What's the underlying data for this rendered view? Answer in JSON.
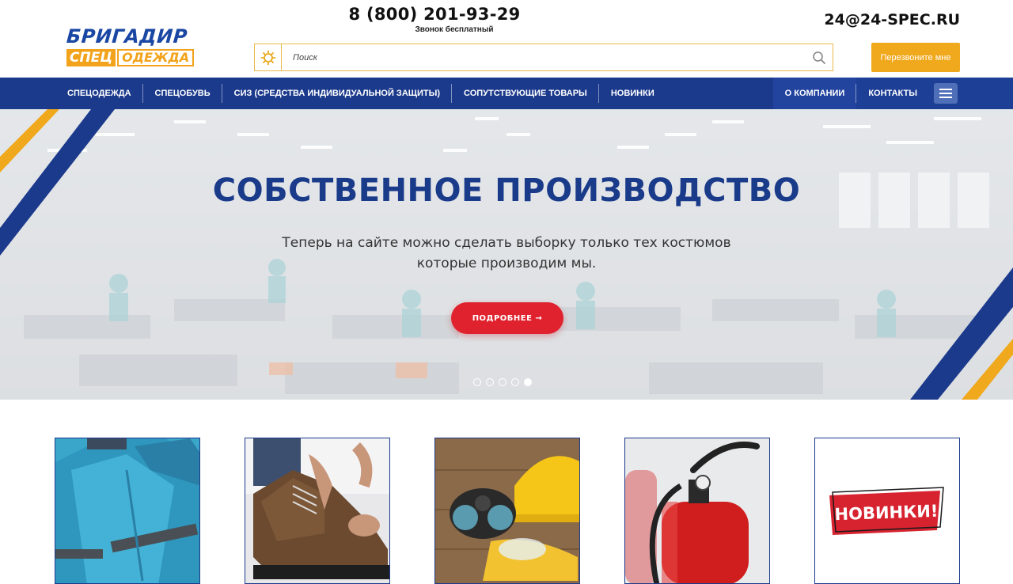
{
  "header": {
    "logo": {
      "top": "БРИГАДИР",
      "spec": "СПЕЦ",
      "od": "ОДЕЖДА"
    },
    "phone": "8 (800) 201-93-29",
    "phone_note": "Звонок бесплатный",
    "email": "24@24-SPEC.RU",
    "search_placeholder": "Поиск",
    "callback_label": "Перезвоните мне"
  },
  "nav": {
    "items": [
      {
        "label": "СПЕЦОДЕЖДА"
      },
      {
        "label": "СПЕЦОБУВЬ"
      },
      {
        "label": "СИЗ (СРЕДСТВА ИНДИВИДУАЛЬНОЙ ЗАЩИТЫ)"
      },
      {
        "label": "СОПУТСТВУЮЩИЕ ТОВАРЫ"
      },
      {
        "label": "НОВИНКИ"
      }
    ],
    "right_items": [
      {
        "label": "О КОМПАНИИ"
      },
      {
        "label": "КОНТАКТЫ"
      }
    ],
    "menu_icon": "hamburger-icon"
  },
  "hero": {
    "title": "СОБСТВЕННОЕ ПРОИЗВОДСТВО",
    "text_line1": "Теперь на сайте можно сделать выборку только тех костюмов",
    "text_line2": "которые производим мы.",
    "button_label": "ПОДРОБНЕЕ →",
    "slides_count": 5,
    "active_slide": 5
  },
  "categories": {
    "items": [
      {
        "image": "workwear-jacket"
      },
      {
        "image": "safety-boot"
      },
      {
        "image": "respirator-helmet"
      },
      {
        "image": "fire-extinguisher"
      },
      {
        "image": "new-items-banner",
        "banner_text": "НОВИНКИ!"
      }
    ]
  },
  "colors": {
    "brand_blue": "#1c3a8c",
    "brand_orange": "#f0a81c",
    "cta_red": "#e0222e"
  }
}
